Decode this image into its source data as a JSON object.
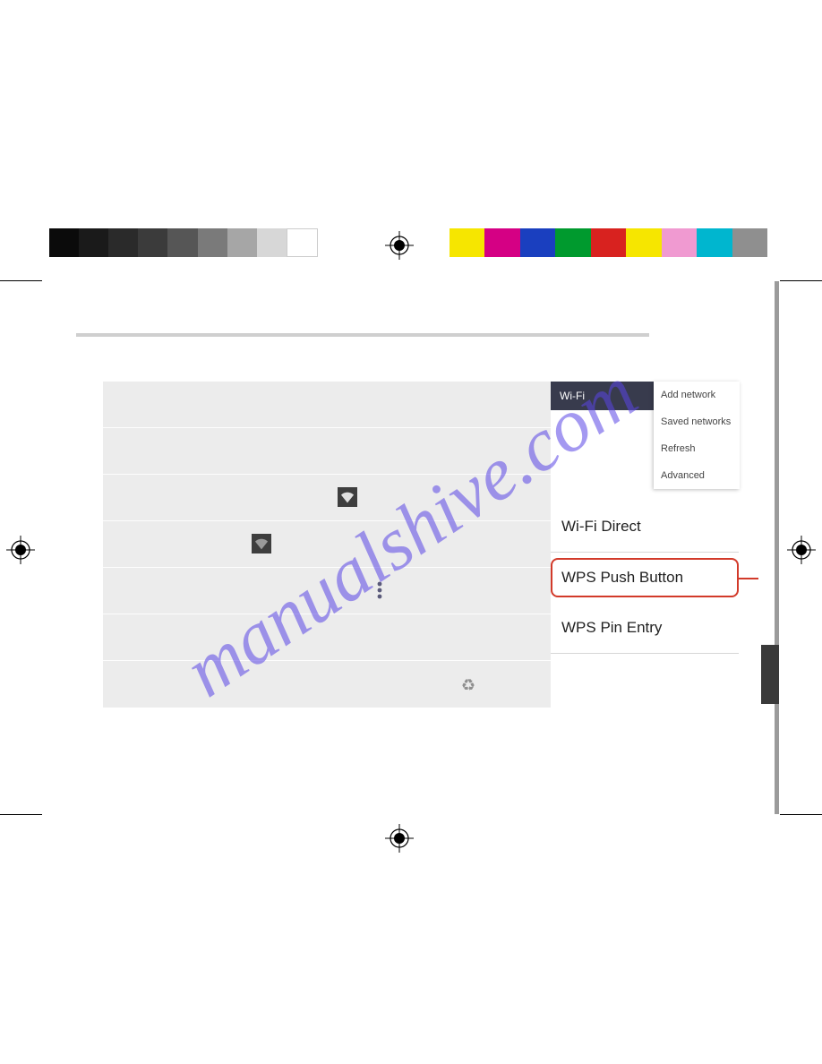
{
  "watermark": "manualshive.com",
  "color_bar_gray": [
    "#0b0b0b",
    "#1a1a1a",
    "#2a2a2a",
    "#3b3b3b",
    "#565656",
    "#7a7a7a",
    "#a6a6a6",
    "#d7d7d7",
    "#ffffff"
  ],
  "color_bar_color": [
    "#f6e600",
    "#d50084",
    "#1a3fbf",
    "#009a2e",
    "#d8221f",
    "#f6e600",
    "#f09ad1",
    "#00b6cf",
    "#8f8f8f"
  ],
  "topbar": {
    "title": "Wi-Fi"
  },
  "dropdown": {
    "items": [
      "Add network",
      "Saved networks",
      "Refresh",
      "Advanced"
    ]
  },
  "side_list": {
    "items": [
      {
        "label": "Wi-Fi Direct",
        "highlight": false
      },
      {
        "label": "WPS Push Button",
        "highlight": true
      },
      {
        "label": "WPS Pin Entry",
        "highlight": false
      }
    ]
  },
  "icons": {
    "wifi_locked": "wifi-locked-icon",
    "wifi": "wifi-icon",
    "more": "more-vert-icon",
    "recycle": "recycle-icon"
  }
}
